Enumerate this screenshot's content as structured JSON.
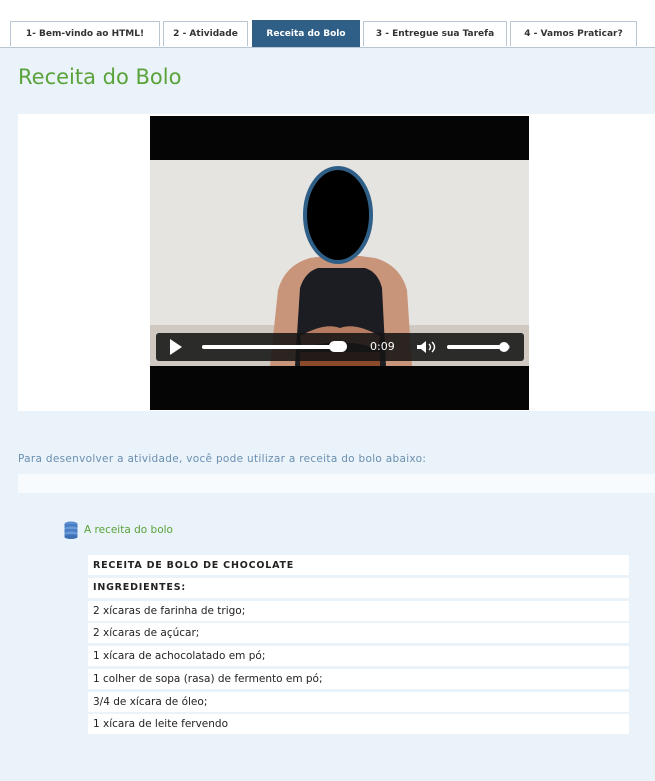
{
  "tabs": [
    {
      "label": "1- Bem-vindo ao HTML!",
      "active": false
    },
    {
      "label": "2 - Atividade",
      "active": false
    },
    {
      "label": "Receita do Bolo",
      "active": true
    },
    {
      "label": "3 - Entregue sua Tarefa",
      "active": false
    },
    {
      "label": "4 - Vamos Praticar?",
      "active": false
    }
  ],
  "page": {
    "title": "Receita do Bolo",
    "instruction": "Para desenvolver a atividade, você pode utilizar a receita do bolo abaixo:"
  },
  "video": {
    "time": "0:09",
    "progress_fraction": 0.97,
    "volume_fraction": 0.9
  },
  "recipe": {
    "link_label": "A receita do bolo",
    "icon": "database-icon",
    "lines": [
      {
        "text": "RECEITA DE BOLO DE CHOCOLATE",
        "bold": true
      },
      {
        "text": "INGREDIENTES:",
        "bold": true
      },
      {
        "text": "2 xícaras de farinha de trigo;",
        "bold": false
      },
      {
        "text": "2 xícaras de açúcar;",
        "bold": false
      },
      {
        "text": "1 xícara de achocolatado em pó;",
        "bold": false
      },
      {
        "text": "1 colher de sopa (rasa) de fermento em pó;",
        "bold": false
      },
      {
        "text": "3/4 de xícara de óleo;",
        "bold": false
      },
      {
        "text": "1 xícara de leite fervendo",
        "bold": false
      }
    ]
  },
  "colors": {
    "title_green": "#5aa33a",
    "active_tab": "#2f5f86",
    "instruction_blue": "#6b8fb0",
    "content_bg": "#eaf2fa"
  }
}
